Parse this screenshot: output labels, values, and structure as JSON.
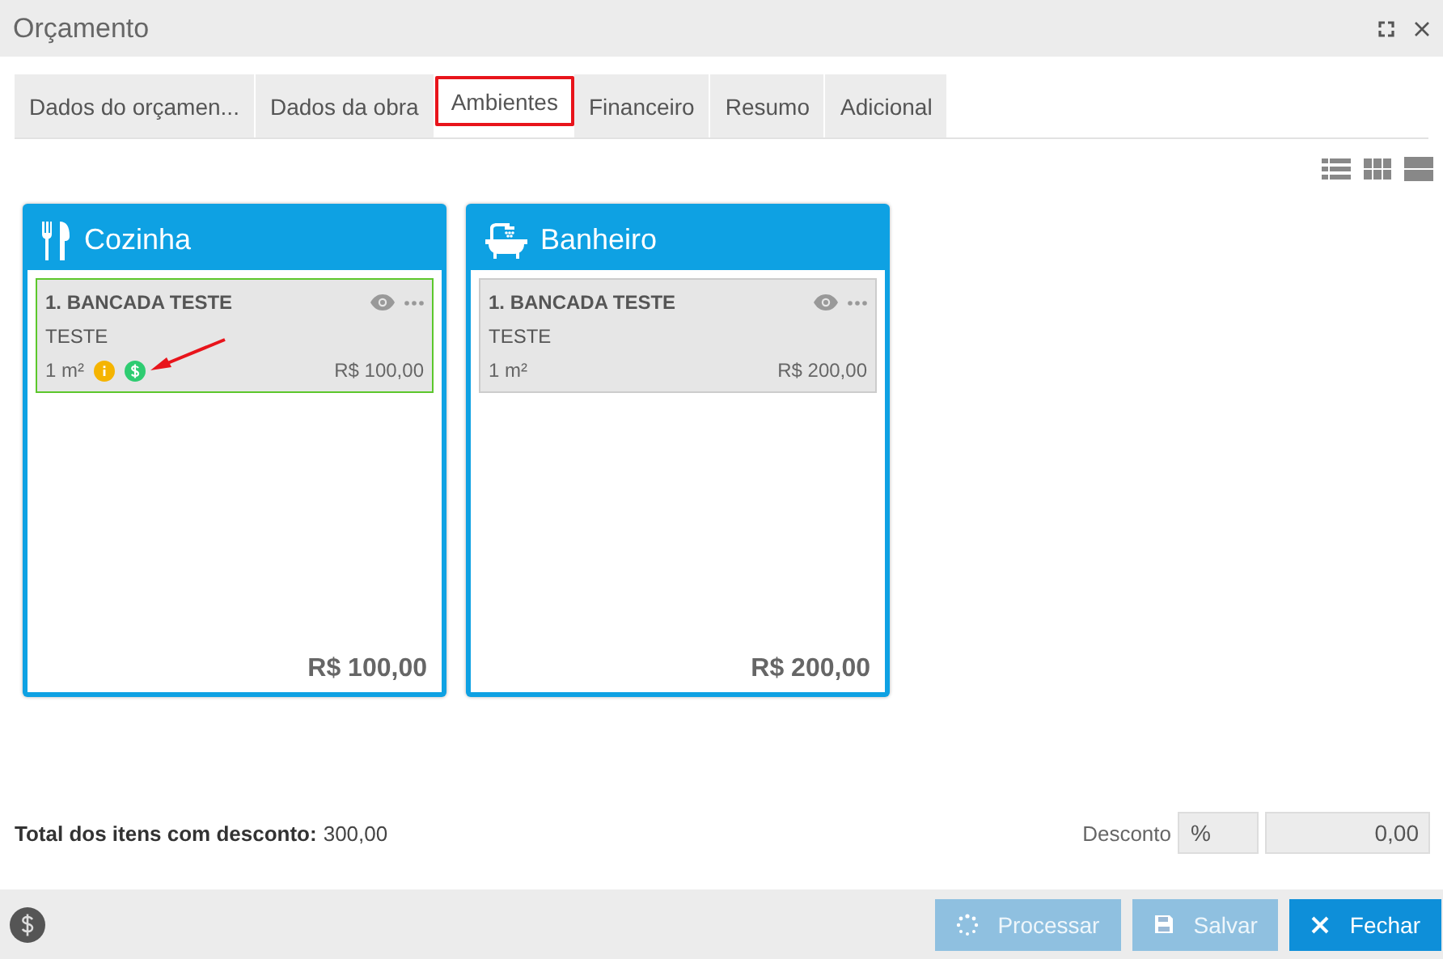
{
  "window": {
    "title": "Orçamento"
  },
  "tabs": [
    {
      "label": "Dados do orçamen...",
      "selected": false
    },
    {
      "label": "Dados da obra",
      "selected": false
    },
    {
      "label": "Ambientes",
      "selected": true
    },
    {
      "label": "Financeiro",
      "selected": false
    },
    {
      "label": "Resumo",
      "selected": false
    },
    {
      "label": "Adicional",
      "selected": false
    }
  ],
  "rooms": [
    {
      "name": "Cozinha",
      "kind": "kitchen",
      "total": "R$ 100,00",
      "items": [
        {
          "title": "1. BANCADA TESTE",
          "description": "TESTE",
          "quantity": "1 m²",
          "price": "R$ 100,00",
          "selected": true,
          "badges": [
            {
              "kind": "info",
              "color": "#f5b400"
            },
            {
              "kind": "money",
              "color": "#2ecc71"
            }
          ]
        }
      ]
    },
    {
      "name": "Banheiro",
      "kind": "bathroom",
      "total": "R$ 200,00",
      "items": [
        {
          "title": "1. BANCADA TESTE",
          "description": "TESTE",
          "quantity": "1 m²",
          "price": "R$ 200,00",
          "selected": false
        }
      ]
    }
  ],
  "totals": {
    "label": "Total dos itens com desconto:",
    "value": "300,00"
  },
  "discount": {
    "label": "Desconto",
    "type": "%",
    "value": "0,00"
  },
  "buttons": [
    {
      "label": "Processar",
      "kind": "process",
      "disabled": true
    },
    {
      "label": "Salvar",
      "kind": "save",
      "disabled": true
    },
    {
      "label": "Fechar",
      "kind": "close",
      "disabled": false
    }
  ]
}
